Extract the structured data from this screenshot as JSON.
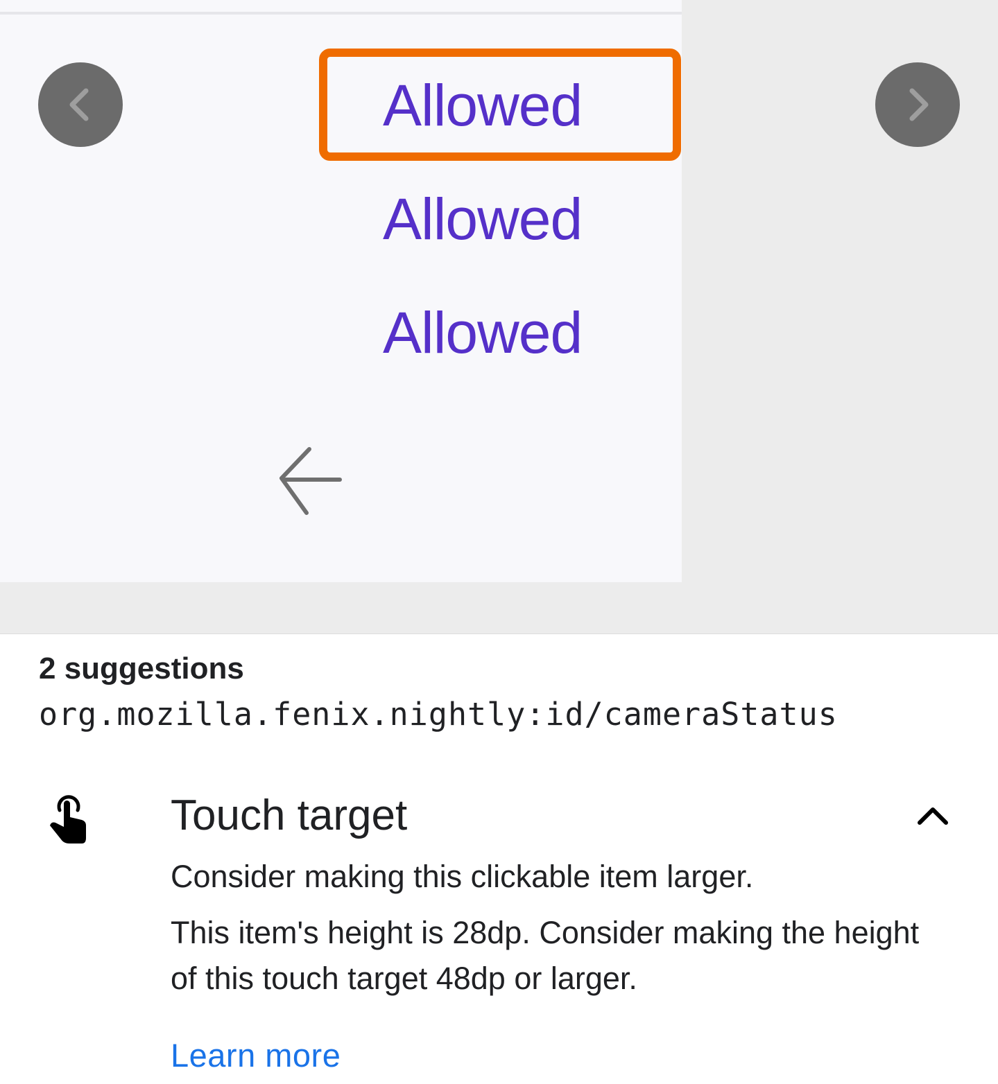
{
  "preview": {
    "items": [
      {
        "label": "Allowed"
      },
      {
        "label": "Allowed"
      },
      {
        "label": "Allowed"
      }
    ],
    "prev_icon": "chevron-left-icon",
    "next_icon": "chevron-right-icon",
    "back_icon": "arrow-back-icon",
    "highlight_color": "#ef6c00",
    "text_color": "#5530c9"
  },
  "panel": {
    "count_label": "2 suggestions",
    "resource_id": "org.mozilla.fenix.nightly:id/cameraStatus",
    "check": {
      "icon": "touch-app-icon",
      "title": "Touch target",
      "summary": "Consider making this clickable item larger.",
      "detail": "This item's height is 28dp. Consider making the height of this touch target 48dp or larger.",
      "collapse_icon": "chevron-up-icon",
      "link": "Learn more"
    },
    "link_color": "#1a73e8"
  }
}
